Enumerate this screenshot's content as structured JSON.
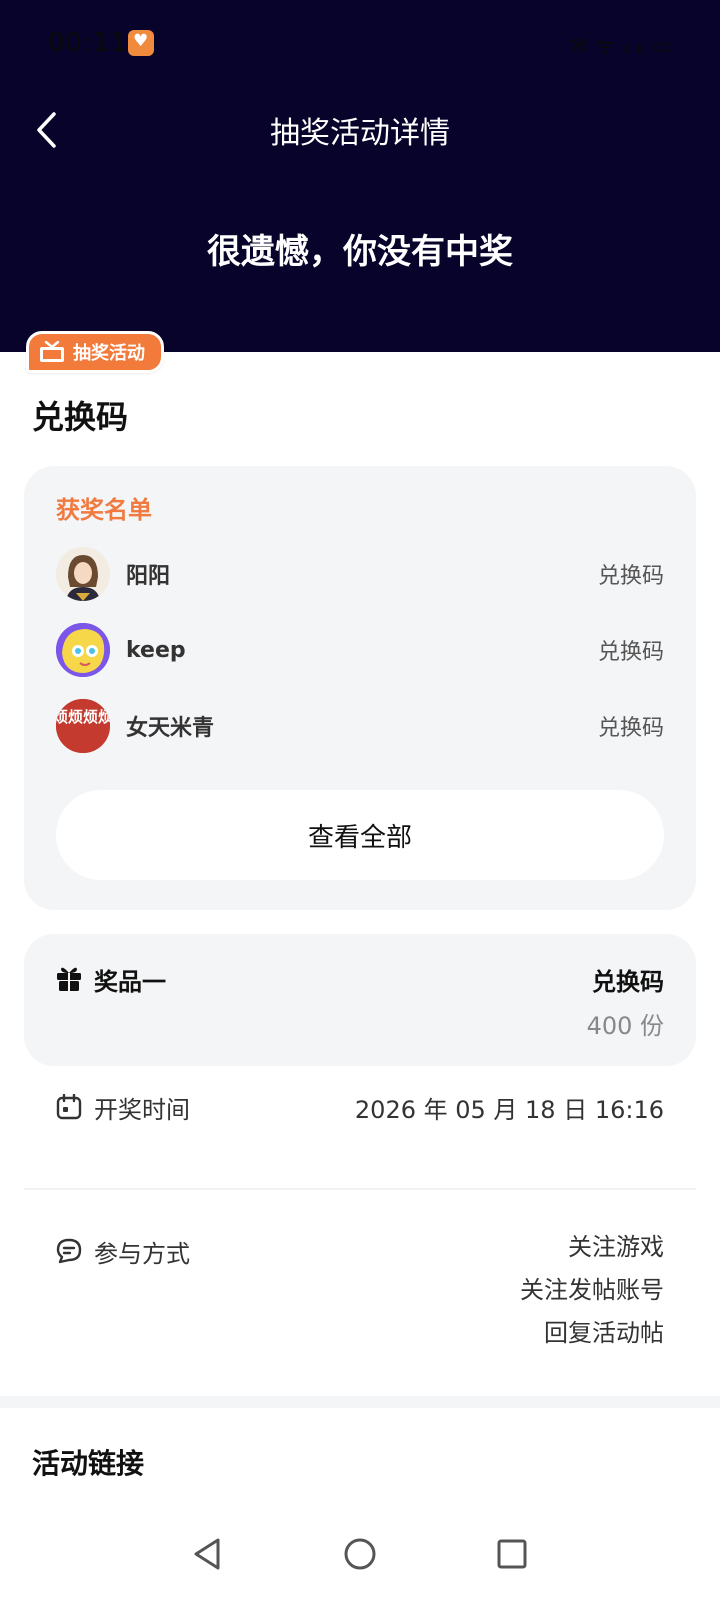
{
  "status_bar": {
    "time": "00:11",
    "right_text": "✉ ᯤ ᵢₗ ᵢₗ ▭"
  },
  "header": {
    "title": "抽奖活动详情",
    "result": "很遗憾，你没有中奖",
    "background_color": "#07032a"
  },
  "badge": {
    "label": "抽奖活动",
    "color": "#f27a3a"
  },
  "section_title": "兑换码",
  "winners": {
    "heading": "获奖名单",
    "list": [
      {
        "name": "阳阳",
        "prize": "兑换码",
        "avatar": "anime-character-avatar"
      },
      {
        "name": "keep",
        "prize": "兑换码",
        "avatar": "cartoon-avatar"
      },
      {
        "name": "女天米青",
        "prize": "兑换码",
        "avatar": "red-text-avatar",
        "avatar_text": "烦烦烦烦"
      }
    ],
    "view_all": "查看全部"
  },
  "prize": {
    "label": "奖品一",
    "name": "兑换码",
    "count": "400 份"
  },
  "draw_time": {
    "label": "开奖时间",
    "value": "2026 年 05 月 18 日 16:16"
  },
  "participation": {
    "label": "参与方式",
    "methods": [
      "关注游戏",
      "关注发帖账号",
      "回复活动帖"
    ]
  },
  "activity_link": {
    "title": "活动链接"
  }
}
